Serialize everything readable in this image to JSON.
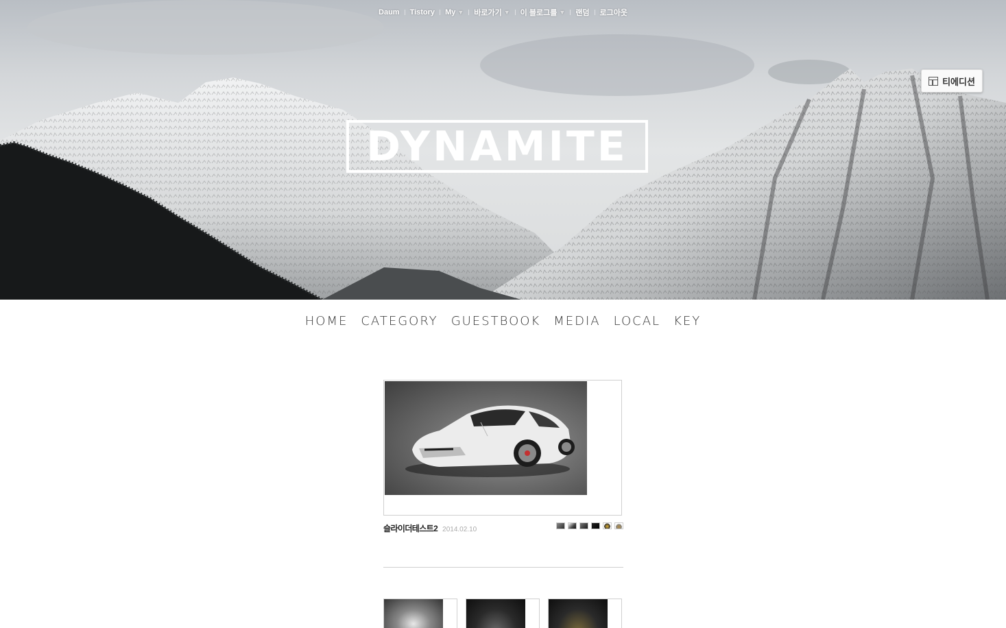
{
  "topbar": {
    "items": [
      {
        "label": "Daum",
        "caret": false
      },
      {
        "label": "Tistory",
        "caret": false
      },
      {
        "label": "My",
        "caret": true
      },
      {
        "label": "바로가기",
        "caret": true
      },
      {
        "label": "이 블로그를",
        "caret": true
      },
      {
        "label": "랜덤",
        "caret": false
      },
      {
        "label": "로그아웃",
        "caret": false
      }
    ],
    "caret_glyph": "▼"
  },
  "tedition": {
    "label": "티에디션",
    "icon": "layout-icon"
  },
  "blog": {
    "title": "DYNAMITE"
  },
  "nav": {
    "items": [
      "HOME",
      "CATEGORY",
      "GUESTBOOK",
      "MEDIA",
      "LOCAL",
      "KEY"
    ]
  },
  "post": {
    "title": "슬라이더테스트2",
    "date": "2014.02.10"
  },
  "colors": {
    "accent": "#222222",
    "muted": "#aaaaaa",
    "border": "#cfcfcf"
  }
}
